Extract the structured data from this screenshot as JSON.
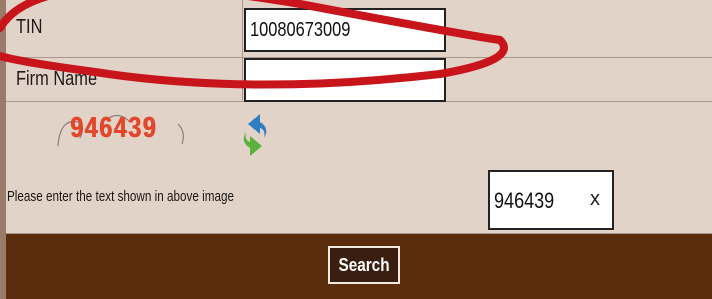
{
  "form": {
    "tin_label": "TIN",
    "tin_value": "10080673009",
    "firm_name_label": "Firm Name",
    "firm_name_value": "",
    "captcha_text": "946439",
    "captcha_prompt": "Please enter the text shown in above image",
    "captcha_answer": "946439",
    "clear_symbol": "x",
    "search_label": "Search",
    "refresh_icon": "refresh-icon"
  },
  "colors": {
    "panel_bg": "#e2d3c9",
    "footer_bg": "#5b2d0c",
    "captcha_text": "#e2462b",
    "highlight_oval": "#c8141b"
  }
}
